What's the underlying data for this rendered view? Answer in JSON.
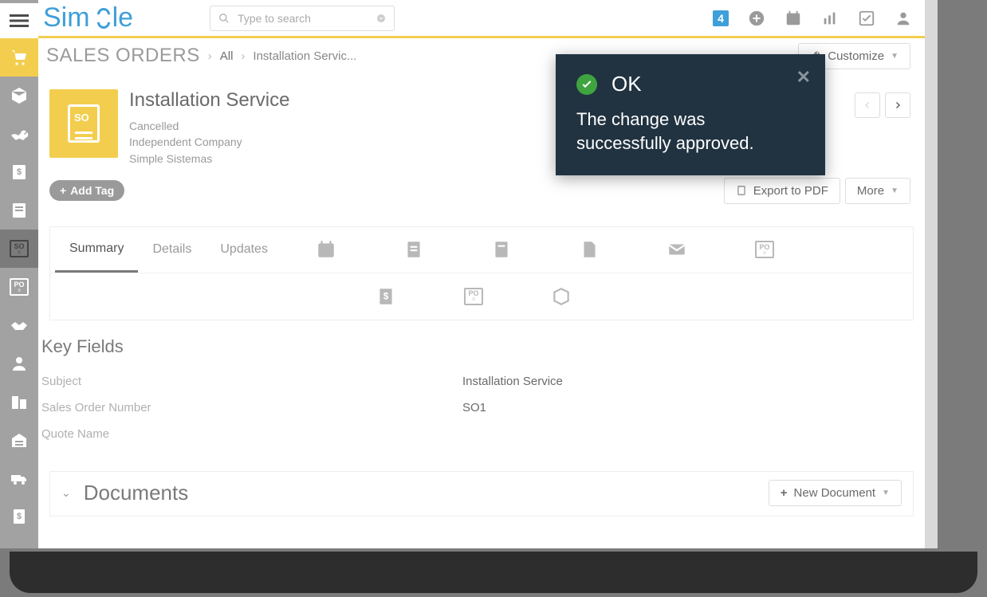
{
  "topbar": {
    "logo_text_a": "Sim",
    "logo_text_b": "le",
    "search_placeholder": "Type to search",
    "notif_count": "4"
  },
  "breadcrumb": {
    "section": "SALES ORDERS",
    "all": "All",
    "current": "Installation Servic...",
    "customize": "Customize"
  },
  "record": {
    "title": "Installation Service",
    "status": "Cancelled",
    "company": "Independent Company",
    "org": "Simple Sistemas",
    "add_tag": "Add Tag",
    "export_pdf": "Export to PDF",
    "more": "More"
  },
  "tabs": {
    "summary": "Summary",
    "details": "Details",
    "updates": "Updates"
  },
  "key_fields": {
    "heading": "Key Fields",
    "rows": [
      {
        "label": "Subject",
        "value": "Installation Service"
      },
      {
        "label": "Sales Order Number",
        "value": "SO1"
      },
      {
        "label": "Quote Name",
        "value": ""
      }
    ]
  },
  "documents": {
    "heading": "Documents",
    "new_btn": "New Document"
  },
  "toast": {
    "title": "OK",
    "message": "The change was successfully approved."
  }
}
